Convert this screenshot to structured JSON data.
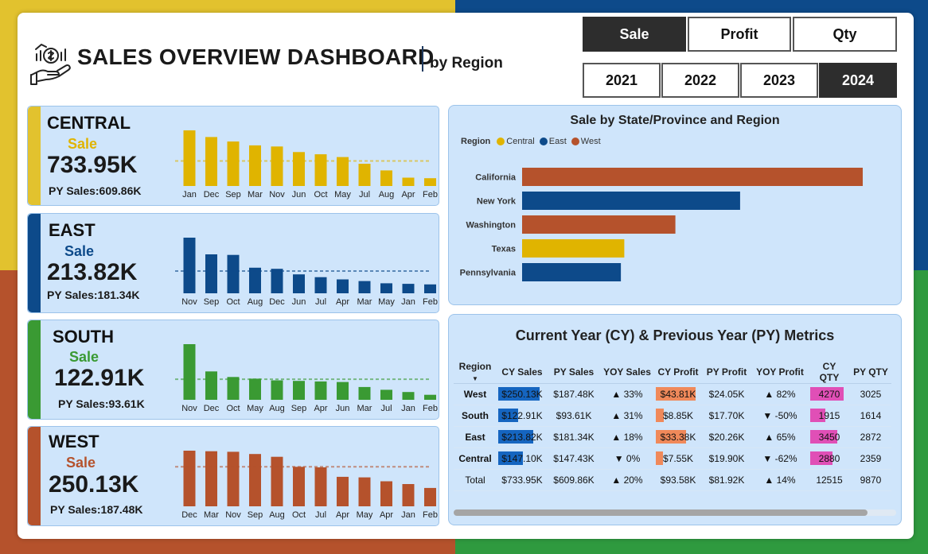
{
  "header": {
    "title": "SALES OVERVIEW DASHBOARD",
    "subtitle": "by Region",
    "logo_icon": "money-hand-chart-icon"
  },
  "metric_buttons": [
    {
      "label": "Sale",
      "active": true
    },
    {
      "label": "Profit",
      "active": false
    },
    {
      "label": "Qty",
      "active": false
    }
  ],
  "year_buttons": [
    {
      "label": "2021",
      "active": false
    },
    {
      "label": "2022",
      "active": false
    },
    {
      "label": "2023",
      "active": false
    },
    {
      "label": "2024",
      "active": true
    }
  ],
  "colors": {
    "central": "#e0b400",
    "east": "#0d4a8a",
    "south": "#3a9a33",
    "west": "#b5522c"
  },
  "regions": [
    {
      "name": "CENTRAL",
      "metric_label": "Sale",
      "value": "733.95K",
      "py": "PY Sales:609.86K",
      "chart_data": {
        "type": "bar",
        "categories": [
          "Jan",
          "Dec",
          "Sep",
          "Mar",
          "Nov",
          "Jun",
          "Oct",
          "May",
          "Jul",
          "Aug",
          "Apr",
          "Feb"
        ],
        "values": [
          100,
          88,
          80,
          73,
          71,
          61,
          57,
          52,
          40,
          28,
          15,
          14
        ],
        "average": 45
      }
    },
    {
      "name": "EAST",
      "metric_label": "Sale",
      "value": "213.82K",
      "py": "PY Sales:181.34K",
      "chart_data": {
        "type": "bar",
        "categories": [
          "Nov",
          "Sep",
          "Oct",
          "Aug",
          "Dec",
          "Jun",
          "Jul",
          "Apr",
          "Mar",
          "May",
          "Jan",
          "Feb"
        ],
        "values": [
          100,
          70,
          69,
          46,
          44,
          34,
          29,
          25,
          22,
          18,
          17,
          16
        ],
        "average": 40
      }
    },
    {
      "name": "SOUTH",
      "metric_label": "Sale",
      "value": "122.91K",
      "py": "PY Sales:93.61K",
      "chart_data": {
        "type": "bar",
        "categories": [
          "Nov",
          "Dec",
          "Oct",
          "May",
          "Aug",
          "Sep",
          "Apr",
          "Jun",
          "Mar",
          "Jul",
          "Jan",
          "Feb"
        ],
        "values": [
          100,
          51,
          41,
          38,
          35,
          34,
          33,
          32,
          23,
          18,
          14,
          9
        ],
        "average": 37
      }
    },
    {
      "name": "WEST",
      "metric_label": "Sale",
      "value": "250.13K",
      "py": "PY Sales:187.48K",
      "chart_data": {
        "type": "bar",
        "categories": [
          "Dec",
          "Mar",
          "Nov",
          "Sep",
          "Aug",
          "Oct",
          "Jul",
          "Apr",
          "May",
          "Apr",
          "Jan",
          "Feb"
        ],
        "values": [
          100,
          99,
          98,
          94,
          89,
          71,
          70,
          53,
          52,
          45,
          40,
          33
        ],
        "average": 71
      }
    }
  ],
  "state_chart": {
    "title": "Sale by State/Province and Region",
    "legend_title": "Region",
    "legend": [
      {
        "name": "Central",
        "color": "#e0b400"
      },
      {
        "name": "East",
        "color": "#0d4a8a"
      },
      {
        "name": "West",
        "color": "#b5522c"
      }
    ],
    "chart_data": {
      "type": "bar",
      "orientation": "horizontal",
      "categories": [
        "California",
        "New York",
        "Washington",
        "Texas",
        "Pennsylvania"
      ],
      "values": [
        100,
        64,
        45,
        30,
        29
      ],
      "regions": [
        "West",
        "East",
        "West",
        "Central",
        "East"
      ]
    }
  },
  "metrics": {
    "title": "Current Year (CY) & Previous Year (PY) Metrics",
    "columns": [
      "Region",
      "CY Sales",
      "PY Sales",
      "YOY Sales",
      "CY Profit",
      "PY Profit",
      "YOY Profit",
      "CY QTY",
      "PY QTY"
    ],
    "rows": [
      {
        "region": "West",
        "cy_sales": "$250.13K",
        "py_sales": "$187.48K",
        "yoy_sales": "▲ 33%",
        "cy_profit": "$43.81K",
        "py_profit": "$24.05K",
        "yoy_profit": "▲ 82%",
        "cy_qty": "4270",
        "py_qty": "3025",
        "sales_frac": 1.0,
        "profit_frac": 1.0,
        "qty_frac": 1.0
      },
      {
        "region": "South",
        "cy_sales": "$122.91K",
        "py_sales": "$93.61K",
        "yoy_sales": "▲ 31%",
        "cy_profit": "$8.85K",
        "py_profit": "$17.70K",
        "yoy_profit": "▼ -50%",
        "cy_qty": "1915",
        "py_qty": "1614",
        "sales_frac": 0.49,
        "profit_frac": 0.2,
        "qty_frac": 0.45
      },
      {
        "region": "East",
        "cy_sales": "$213.82K",
        "py_sales": "$181.34K",
        "yoy_sales": "▲ 18%",
        "cy_profit": "$33.38K",
        "py_profit": "$20.26K",
        "yoy_profit": "▲ 65%",
        "cy_qty": "3450",
        "py_qty": "2872",
        "sales_frac": 0.85,
        "profit_frac": 0.76,
        "qty_frac": 0.81
      },
      {
        "region": "Central",
        "cy_sales": "$147.10K",
        "py_sales": "$147.43K",
        "yoy_sales": "▼ 0%",
        "cy_profit": "$7.55K",
        "py_profit": "$19.90K",
        "yoy_profit": "▼ -62%",
        "cy_qty": "2880",
        "py_qty": "2359",
        "sales_frac": 0.59,
        "profit_frac": 0.17,
        "qty_frac": 0.67
      }
    ],
    "total": {
      "region": "Total",
      "cy_sales": "$733.95K",
      "py_sales": "$609.86K",
      "yoy_sales": "▲ 20%",
      "cy_profit": "$93.58K",
      "py_profit": "$81.92K",
      "yoy_profit": "▲ 14%",
      "cy_qty": "12515",
      "py_qty": "9870"
    }
  }
}
